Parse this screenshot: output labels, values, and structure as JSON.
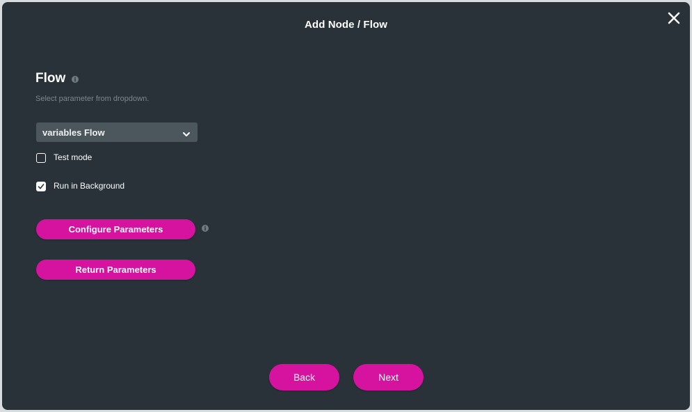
{
  "dialog": {
    "title": "Add Node / Flow",
    "close_icon": "close-icon"
  },
  "flow_section": {
    "title": "Flow",
    "info_icon": "info-icon",
    "info_glyph": "i",
    "subtitle": "Select parameter from dropdown.",
    "dropdown": {
      "selected_value": "variables Flow",
      "icon": "chevron-down-icon"
    },
    "checkboxes": [
      {
        "label": "Test mode",
        "checked": false
      },
      {
        "label": "Run in Background",
        "checked": true
      }
    ]
  },
  "parameter_buttons": {
    "configure_label": "Configure Parameters",
    "configure_info_glyph": "i",
    "return_label": "Return Parameters"
  },
  "footer": {
    "back_label": "Back",
    "next_label": "Next"
  },
  "colors": {
    "modal_background": "#283238",
    "accent": "#d6139f",
    "dropdown_background": "#4c575d",
    "muted_text": "#7d878e"
  }
}
